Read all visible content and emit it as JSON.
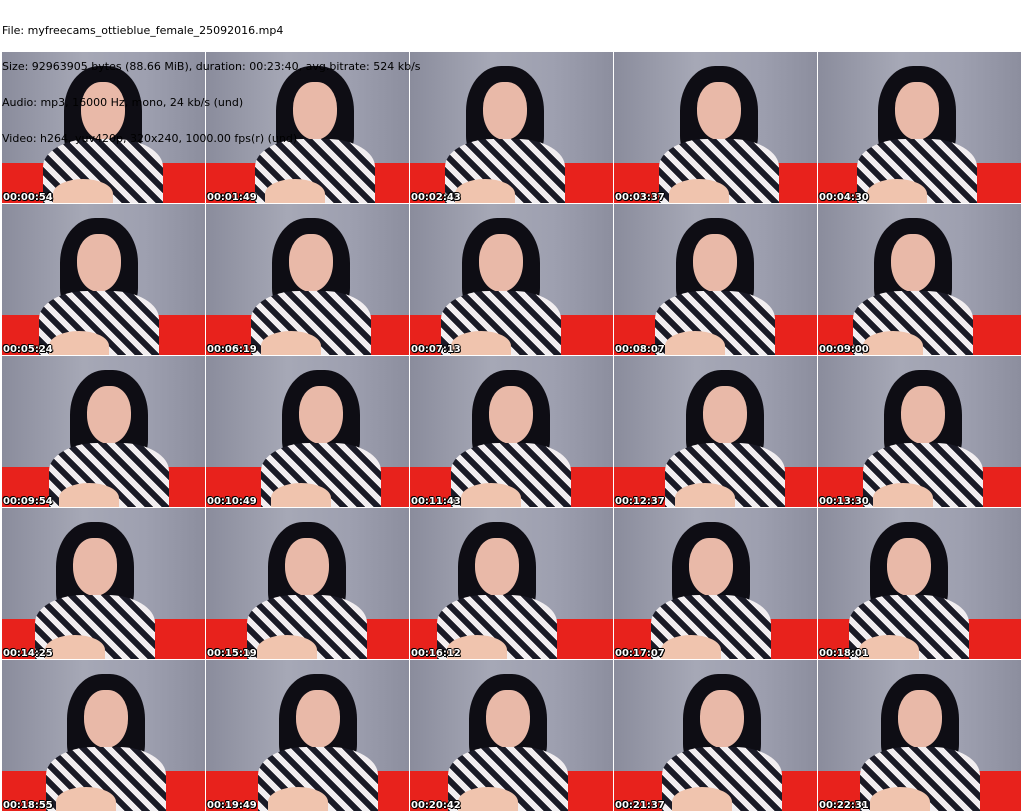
{
  "header": {
    "file": "File: myfreecams_ottieblue_female_25092016.mp4",
    "size": "Size: 92963905 bytes (88.66 MiB), duration: 00:23:40, avg.bitrate: 524 kb/s",
    "audio": "Audio: mp3, 16000 Hz, mono, 24 kb/s (und)",
    "video": "Video: h264, yuv420p, 320x240, 1000.00 fps(r) (und)"
  },
  "thumbnails": [
    "00:00:54",
    "00:01:49",
    "00:02:43",
    "00:03:37",
    "00:04:30",
    "00:05:24",
    "00:06:19",
    "00:07:13",
    "00:08:07",
    "00:09:00",
    "00:09:54",
    "00:10:49",
    "00:11:43",
    "00:12:37",
    "00:13:30",
    "00:14:25",
    "00:15:19",
    "00:16:12",
    "00:17:07",
    "00:18:01",
    "00:18:55",
    "00:19:49",
    "00:20:42",
    "00:21:37",
    "00:22:31"
  ]
}
